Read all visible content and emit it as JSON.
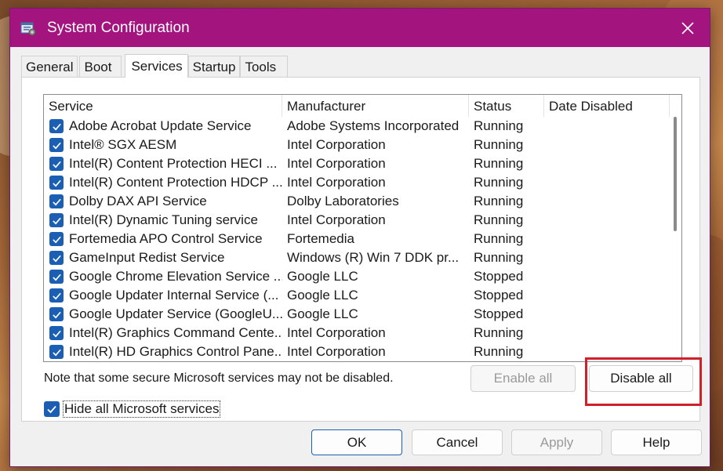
{
  "window": {
    "title": "System Configuration",
    "title_bar_color": "#a3147f"
  },
  "tabs": [
    {
      "label": "General",
      "active": false
    },
    {
      "label": "Boot",
      "active": false
    },
    {
      "label": "Services",
      "active": true
    },
    {
      "label": "Startup",
      "active": false
    },
    {
      "label": "Tools",
      "active": false
    }
  ],
  "table": {
    "columns": [
      "Service",
      "Manufacturer",
      "Status",
      "Date Disabled"
    ],
    "rows": [
      {
        "service": "Adobe Acrobat Update Service",
        "manufacturer": "Adobe Systems Incorporated",
        "status": "Running",
        "date_disabled": "",
        "checked": true
      },
      {
        "service": "Intel® SGX AESM",
        "manufacturer": "Intel Corporation",
        "status": "Running",
        "date_disabled": "",
        "checked": true
      },
      {
        "service": "Intel(R) Content Protection HECI ...",
        "manufacturer": "Intel Corporation",
        "status": "Running",
        "date_disabled": "",
        "checked": true
      },
      {
        "service": "Intel(R) Content Protection HDCP ...",
        "manufacturer": "Intel Corporation",
        "status": "Running",
        "date_disabled": "",
        "checked": true
      },
      {
        "service": "Dolby DAX API Service",
        "manufacturer": "Dolby Laboratories",
        "status": "Running",
        "date_disabled": "",
        "checked": true
      },
      {
        "service": "Intel(R) Dynamic Tuning service",
        "manufacturer": "Intel Corporation",
        "status": "Running",
        "date_disabled": "",
        "checked": true
      },
      {
        "service": "Fortemedia APO Control Service",
        "manufacturer": "Fortemedia",
        "status": "Running",
        "date_disabled": "",
        "checked": true
      },
      {
        "service": "GameInput Redist Service",
        "manufacturer": "Windows (R) Win 7 DDK pr...",
        "status": "Running",
        "date_disabled": "",
        "checked": true
      },
      {
        "service": "Google Chrome Elevation Service ...",
        "manufacturer": "Google LLC",
        "status": "Stopped",
        "date_disabled": "",
        "checked": true
      },
      {
        "service": "Google Updater Internal Service (...",
        "manufacturer": "Google LLC",
        "status": "Stopped",
        "date_disabled": "",
        "checked": true
      },
      {
        "service": "Google Updater Service (GoogleU...",
        "manufacturer": "Google LLC",
        "status": "Stopped",
        "date_disabled": "",
        "checked": true
      },
      {
        "service": "Intel(R) Graphics Command Cente...",
        "manufacturer": "Intel Corporation",
        "status": "Running",
        "date_disabled": "",
        "checked": true
      },
      {
        "service": "Intel(R) HD Graphics Control Pane...",
        "manufacturer": "Intel Corporation",
        "status": "Running",
        "date_disabled": "",
        "checked": true
      }
    ]
  },
  "note": "Note that some secure Microsoft services may not be disabled.",
  "buttons": {
    "enable_all": "Enable all",
    "disable_all": "Disable all",
    "ok": "OK",
    "cancel": "Cancel",
    "apply": "Apply",
    "help": "Help"
  },
  "hide_ms": {
    "label": "Hide all Microsoft services",
    "checked": true
  },
  "colors": {
    "checkbox": "#1a5fb4",
    "highlight": "#d0202a"
  }
}
